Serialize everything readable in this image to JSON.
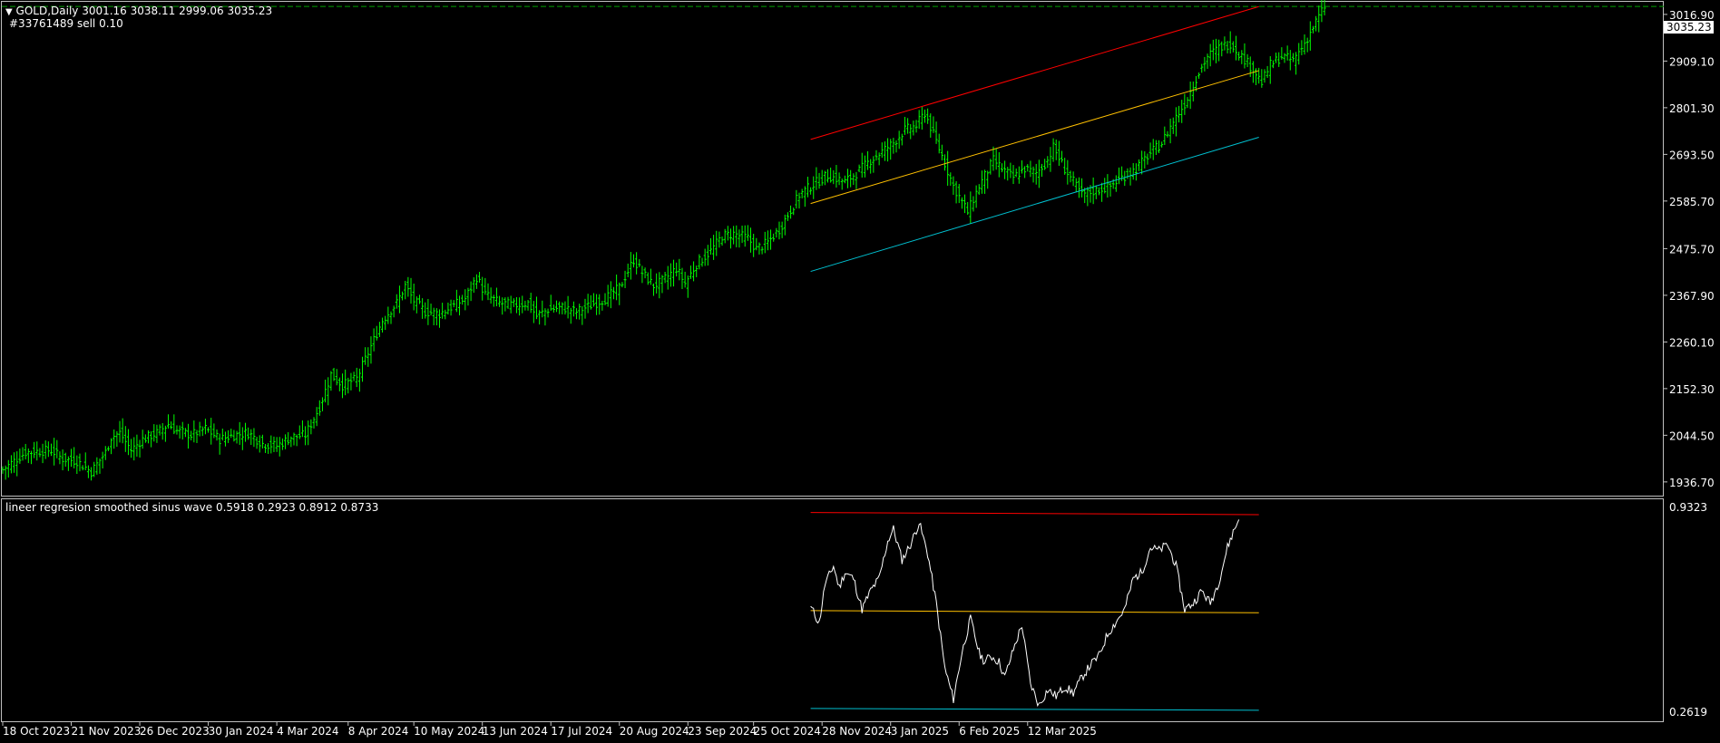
{
  "main_panel": {
    "symbol_line": "GOLD,Daily  3001.16 3038.11 2999.06 3035.23",
    "order_line": "#33761489 sell 0.10",
    "price_tag": "3035.23",
    "menu_icon": "triangle-down-icon"
  },
  "indicator_panel": {
    "label": "lineer regresion smoothed sinus wave 0.5918 0.2923 0.8912 0.8733"
  },
  "colors": {
    "background": "#000000",
    "frame": "#c0c0c0",
    "bull_bar": "#00ff00",
    "bear_bar": "#00ff00",
    "upper_channel": "#ff0000",
    "mid_channel": "#ffc000",
    "lower_channel": "#00c0d0",
    "sine_wave": "#ffffff",
    "order_line": "#00a000"
  },
  "chart_data": [
    {
      "type": "ohlc",
      "title": "GOLD,Daily",
      "y_ticks": [
        "3016.90",
        "2909.10",
        "2801.30",
        "2693.50",
        "2585.70",
        "2475.70",
        "2367.90",
        "2260.10",
        "2152.30",
        "2044.50",
        "1936.70"
      ],
      "x_ticks": [
        "18 Oct 2023",
        "21 Nov 2023",
        "26 Dec 2023",
        "30 Jan 2024",
        "4 Mar 2024",
        "8 Apr 2024",
        "10 May 2024",
        "13 Jun 2024",
        "17 Jul 2024",
        "20 Aug 2024",
        "23 Sep 2024",
        "25 Oct 2024",
        "28 Nov 2024",
        "3 Jan 2025",
        "6 Feb 2025",
        "12 Mar 2025"
      ],
      "ylim": [
        1905,
        3046
      ],
      "close_path": [
        [
          0,
          1965
        ],
        [
          8,
          2005
        ],
        [
          17,
          2010
        ],
        [
          21,
          1990
        ],
        [
          26,
          1985
        ],
        [
          31,
          1960
        ],
        [
          36,
          2005
        ],
        [
          38,
          2040
        ],
        [
          41,
          2050
        ],
        [
          45,
          2010
        ],
        [
          49,
          2035
        ],
        [
          54,
          2050
        ],
        [
          58,
          2070
        ],
        [
          61,
          2055
        ],
        [
          66,
          2045
        ],
        [
          71,
          2060
        ],
        [
          76,
          2035
        ],
        [
          81,
          2045
        ],
        [
          86,
          2050
        ],
        [
          91,
          2025
        ],
        [
          96,
          2020
        ],
        [
          101,
          2040
        ],
        [
          106,
          2045
        ],
        [
          111,
          2110
        ],
        [
          115,
          2185
        ],
        [
          119,
          2160
        ],
        [
          124,
          2175
        ],
        [
          129,
          2250
        ],
        [
          133,
          2310
        ],
        [
          138,
          2350
        ],
        [
          141,
          2390
        ],
        [
          144,
          2355
        ],
        [
          148,
          2330
        ],
        [
          153,
          2325
        ],
        [
          157,
          2340
        ],
        [
          162,
          2360
        ],
        [
          166,
          2410
        ],
        [
          169,
          2370
        ],
        [
          174,
          2350
        ],
        [
          179,
          2345
        ],
        [
          184,
          2350
        ],
        [
          187,
          2320
        ],
        [
          191,
          2335
        ],
        [
          196,
          2340
        ],
        [
          201,
          2330
        ],
        [
          206,
          2345
        ],
        [
          211,
          2360
        ],
        [
          216,
          2385
        ],
        [
          221,
          2450
        ],
        [
          224,
          2420
        ],
        [
          228,
          2390
        ],
        [
          231,
          2400
        ],
        [
          236,
          2430
        ],
        [
          239,
          2395
        ],
        [
          243,
          2440
        ],
        [
          248,
          2470
        ],
        [
          252,
          2505
        ],
        [
          256,
          2510
        ],
        [
          261,
          2500
        ],
        [
          264,
          2475
        ],
        [
          268,
          2490
        ],
        [
          272,
          2520
        ],
        [
          276,
          2565
        ],
        [
          279,
          2600
        ],
        [
          284,
          2625
        ],
        [
          289,
          2645
        ],
        [
          295,
          2630
        ],
        [
          299,
          2650
        ],
        [
          304,
          2680
        ],
        [
          308,
          2700
        ],
        [
          312,
          2720
        ],
        [
          316,
          2750
        ],
        [
          320,
          2760
        ],
        [
          323,
          2790
        ],
        [
          326,
          2740
        ],
        [
          329,
          2690
        ],
        [
          333,
          2620
        ],
        [
          338,
          2560
        ],
        [
          342,
          2620
        ],
        [
          347,
          2680
        ],
        [
          350,
          2660
        ],
        [
          354,
          2640
        ],
        [
          358,
          2660
        ],
        [
          362,
          2650
        ],
        [
          366,
          2680
        ],
        [
          368,
          2710
        ],
        [
          372,
          2660
        ],
        [
          375,
          2630
        ],
        [
          378,
          2600
        ],
        [
          383,
          2610
        ],
        [
          388,
          2620
        ],
        [
          392,
          2640
        ],
        [
          397,
          2660
        ],
        [
          401,
          2690
        ],
        [
          406,
          2720
        ],
        [
          410,
          2770
        ],
        [
          414,
          2810
        ],
        [
          418,
          2870
        ],
        [
          422,
          2920
        ],
        [
          426,
          2940
        ],
        [
          430,
          2950
        ],
        [
          434,
          2920
        ],
        [
          438,
          2890
        ],
        [
          441,
          2860
        ],
        [
          444,
          2900
        ],
        [
          448,
          2920
        ],
        [
          452,
          2910
        ],
        [
          456,
          2950
        ],
        [
          460,
          3000
        ],
        [
          463,
          3035
        ]
      ],
      "channel": {
        "start_bar": 283,
        "end_bar": 440,
        "upper": [
          2728,
          3035
        ],
        "mid": [
          2580,
          2887
        ],
        "lower": [
          2423,
          2733
        ]
      },
      "order_price": 3035.23
    },
    {
      "type": "line",
      "name": "lineer regresion smoothed sinus wave",
      "values_shown": [
        0.5918,
        0.2923,
        0.8912,
        0.8733
      ],
      "y_ticks": [
        "0.9323",
        "0.2619"
      ],
      "ylim": [
        0.2619,
        0.9323
      ],
      "levels": {
        "upper": [
          0.913,
          0.906
        ],
        "mid": [
          0.596,
          0.589
        ],
        "lower": [
          0.28,
          0.274
        ]
      },
      "points": [
        [
          0,
          0.61
        ],
        [
          3,
          0.555
        ],
        [
          5,
          0.68
        ],
        [
          8,
          0.74
        ],
        [
          10,
          0.67
        ],
        [
          12,
          0.72
        ],
        [
          15,
          0.7
        ],
        [
          18,
          0.6
        ],
        [
          21,
          0.66
        ],
        [
          24,
          0.7
        ],
        [
          27,
          0.82
        ],
        [
          29,
          0.86
        ],
        [
          32,
          0.76
        ],
        [
          35,
          0.81
        ],
        [
          38,
          0.88
        ],
        [
          41,
          0.78
        ],
        [
          44,
          0.62
        ],
        [
          47,
          0.41
        ],
        [
          50,
          0.31
        ],
        [
          53,
          0.46
        ],
        [
          56,
          0.57
        ],
        [
          59,
          0.46
        ],
        [
          61,
          0.43
        ],
        [
          63,
          0.45
        ],
        [
          66,
          0.43
        ],
        [
          68,
          0.38
        ],
        [
          71,
          0.47
        ],
        [
          74,
          0.55
        ],
        [
          77,
          0.36
        ],
        [
          80,
          0.29
        ],
        [
          83,
          0.34
        ],
        [
          86,
          0.32
        ],
        [
          89,
          0.35
        ],
        [
          92,
          0.33
        ],
        [
          95,
          0.38
        ],
        [
          98,
          0.42
        ],
        [
          101,
          0.45
        ],
        [
          104,
          0.52
        ],
        [
          107,
          0.56
        ],
        [
          110,
          0.6
        ],
        [
          113,
          0.7
        ],
        [
          116,
          0.72
        ],
        [
          119,
          0.8
        ],
        [
          122,
          0.79
        ],
        [
          125,
          0.81
        ],
        [
          128,
          0.74
        ],
        [
          131,
          0.6
        ],
        [
          134,
          0.62
        ],
        [
          137,
          0.66
        ],
        [
          140,
          0.62
        ],
        [
          143,
          0.69
        ],
        [
          146,
          0.8
        ],
        [
          148,
          0.85
        ],
        [
          150,
          0.89
        ]
      ]
    }
  ]
}
